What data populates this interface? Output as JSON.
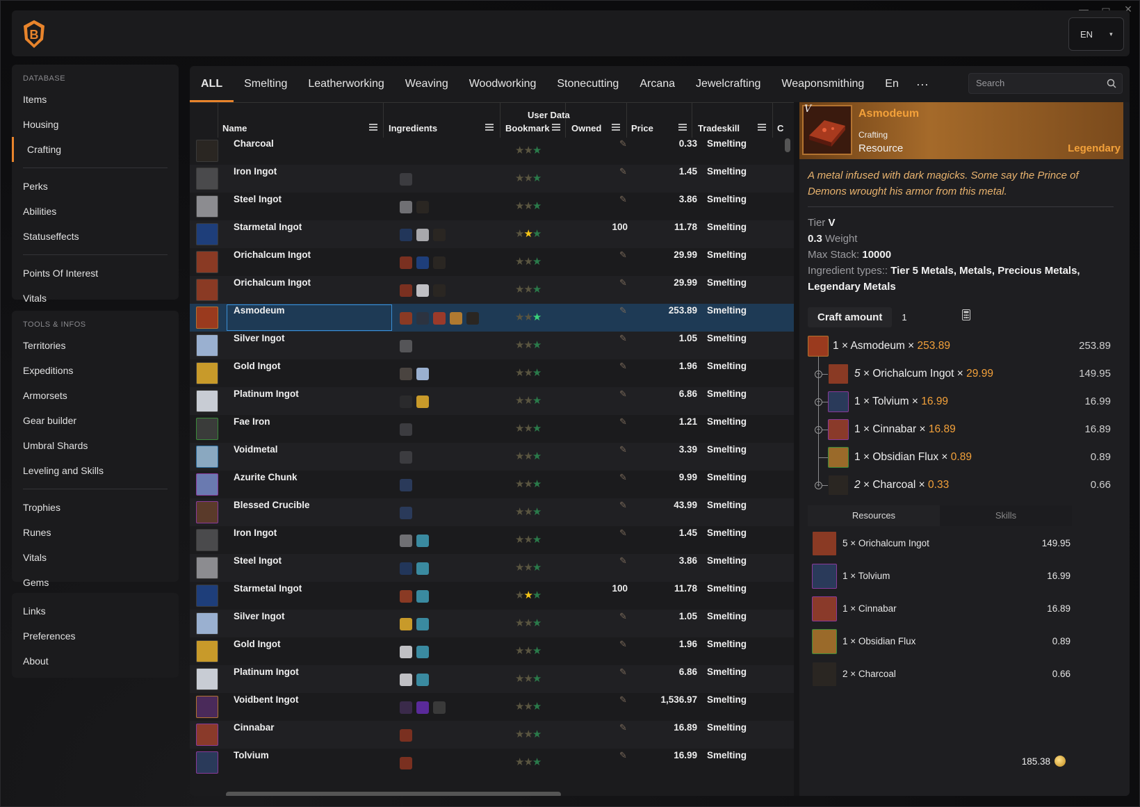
{
  "window": {
    "minimize": "—",
    "maximize": "▭",
    "close": "✕"
  },
  "topbar": {
    "language": "EN",
    "language_caret": "▾"
  },
  "sidebar": {
    "database_heading": "DATABASE",
    "database_items": [
      "Items",
      "Housing",
      "Crafting"
    ],
    "database_items2": [
      "Perks",
      "Abilities",
      "Statuseffects"
    ],
    "database_items3": [
      "Points Of Interest",
      "Vitals"
    ],
    "tools_heading": "TOOLS & INFOS",
    "tools_items": [
      "Territories",
      "Expeditions",
      "Armorsets",
      "Gear builder",
      "Umbral Shards",
      "Leveling and Skills"
    ],
    "tools_items2": [
      "Trophies",
      "Runes",
      "Vitals",
      "Gems"
    ],
    "links_items": [
      "Links",
      "Preferences",
      "About"
    ],
    "active": "Crafting"
  },
  "tabs": [
    "ALL",
    "Smelting",
    "Leatherworking",
    "Weaving",
    "Woodworking",
    "Stonecutting",
    "Arcana",
    "Jewelcrafting",
    "Weaponsmithing",
    "En"
  ],
  "tabs_more": "···",
  "search": {
    "placeholder": "Search"
  },
  "table": {
    "group_header": "User Data",
    "headers": {
      "name": "Name",
      "ingredients": "Ingredients",
      "bookmark": "Bookmark",
      "owned": "Owned",
      "price": "Price",
      "tradeskill": "Tradeskill",
      "extra": "C"
    },
    "rows": [
      {
        "name": "Charcoal",
        "owned": "",
        "price": "0.33",
        "skill": "Smelting",
        "thumb": "#2a2622",
        "frame": "#3a3a3a",
        "ings": [],
        "star": "none"
      },
      {
        "name": "Iron Ingot",
        "owned": "",
        "price": "1.45",
        "skill": "Smelting",
        "thumb": "#4a4a4c",
        "frame": "#3a3a3a",
        "ings": [
          "#3c3c40"
        ],
        "star": "none"
      },
      {
        "name": "Steel Ingot",
        "owned": "",
        "price": "3.86",
        "skill": "Smelting",
        "thumb": "#8c8c90",
        "frame": "#3a3a3a",
        "ings": [
          "#707074",
          "#2a2622"
        ],
        "star": "none"
      },
      {
        "name": "Starmetal Ingot",
        "owned": "100",
        "price": "11.78",
        "skill": "Smelting",
        "thumb": "#1e3e7a",
        "frame": "#3a3a3a",
        "ings": [
          "#22365a",
          "#a8a8ac",
          "#2a2622"
        ],
        "star": "gold"
      },
      {
        "name": "Orichalcum Ingot",
        "owned": "",
        "price": "29.99",
        "skill": "Smelting",
        "thumb": "#8a3a24",
        "frame": "#3a3a3a",
        "ings": [
          "#7a3020",
          "#1e3e7a",
          "#2a2622"
        ],
        "star": "none"
      },
      {
        "name": "Orichalcum Ingot",
        "owned": "",
        "price": "29.99",
        "skill": "Smelting",
        "thumb": "#8a3a24",
        "frame": "#3a3a3a",
        "ings": [
          "#7a3020",
          "#c0c0c4",
          "#2a2622"
        ],
        "star": "none"
      },
      {
        "name": "Asmodeum",
        "owned": "",
        "price": "253.89",
        "skill": "Smelting",
        "thumb": "#9a3a1e",
        "frame": "#b37330",
        "ings": [
          "#8a3a24",
          "#2c3340",
          "#9a3a2a",
          "#b07a30",
          "#2a2622"
        ],
        "star": "green",
        "selected": true
      },
      {
        "name": "Silver Ingot",
        "owned": "",
        "price": "1.05",
        "skill": "Smelting",
        "thumb": "#9ab0d0",
        "frame": "#3a3a3a",
        "ings": [
          "#555558"
        ],
        "star": "none"
      },
      {
        "name": "Gold Ingot",
        "owned": "",
        "price": "1.96",
        "skill": "Smelting",
        "thumb": "#c89a2a",
        "frame": "#3a3a3a",
        "ings": [
          "#4a4440",
          "#9ab0d0"
        ],
        "star": "none"
      },
      {
        "name": "Platinum Ingot",
        "owned": "",
        "price": "6.86",
        "skill": "Smelting",
        "thumb": "#c8ccd4",
        "frame": "#3a3a3a",
        "ings": [
          "#2a2a2c",
          "#c89a2a"
        ],
        "star": "none"
      },
      {
        "name": "Fae Iron",
        "owned": "",
        "price": "1.21",
        "skill": "Smelting",
        "thumb": "#3a3c3a",
        "frame": "#3a8a3a",
        "ings": [
          "#3c3c40"
        ],
        "star": "none"
      },
      {
        "name": "Voidmetal",
        "owned": "",
        "price": "3.39",
        "skill": "Smelting",
        "thumb": "#8aa8c0",
        "frame": "#2a6a9a",
        "ings": [
          "#3c3c40"
        ],
        "star": "none"
      },
      {
        "name": "Azurite Chunk",
        "owned": "",
        "price": "9.99",
        "skill": "Smelting",
        "thumb": "#6a7ab0",
        "frame": "#8a3a9a",
        "ings": [
          "#2a3a5a"
        ],
        "star": "none"
      },
      {
        "name": "Blessed Crucible",
        "owned": "",
        "price": "43.99",
        "skill": "Smelting",
        "thumb": "#5a3a2a",
        "frame": "#8a3a9a",
        "ings": [
          "#2a3a5a"
        ],
        "star": "none"
      },
      {
        "name": "Iron Ingot",
        "owned": "",
        "price": "1.45",
        "skill": "Smelting",
        "thumb": "#4a4a4c",
        "frame": "#3a3a3a",
        "ings": [
          "#707074",
          "#3a8aa0"
        ],
        "star": "none"
      },
      {
        "name": "Steel Ingot",
        "owned": "",
        "price": "3.86",
        "skill": "Smelting",
        "thumb": "#8c8c90",
        "frame": "#3a3a3a",
        "ings": [
          "#22365a",
          "#3a8aa0"
        ],
        "star": "none"
      },
      {
        "name": "Starmetal Ingot",
        "owned": "100",
        "price": "11.78",
        "skill": "Smelting",
        "thumb": "#1e3e7a",
        "frame": "#3a3a3a",
        "ings": [
          "#8a3a24",
          "#3a8aa0"
        ],
        "star": "gold"
      },
      {
        "name": "Silver Ingot",
        "owned": "",
        "price": "1.05",
        "skill": "Smelting",
        "thumb": "#9ab0d0",
        "frame": "#3a3a3a",
        "ings": [
          "#c89a2a",
          "#3a8aa0"
        ],
        "star": "none"
      },
      {
        "name": "Gold Ingot",
        "owned": "",
        "price": "1.96",
        "skill": "Smelting",
        "thumb": "#c89a2a",
        "frame": "#3a3a3a",
        "ings": [
          "#c0c0c4",
          "#3a8aa0"
        ],
        "star": "none"
      },
      {
        "name": "Platinum Ingot",
        "owned": "",
        "price": "6.86",
        "skill": "Smelting",
        "thumb": "#c8ccd4",
        "frame": "#3a3a3a",
        "ings": [
          "#c0c0c4",
          "#3a8aa0"
        ],
        "star": "none"
      },
      {
        "name": "Voidbent Ingot",
        "owned": "",
        "price": "1,536.97",
        "skill": "Smelting",
        "thumb": "#4a2a5a",
        "frame": "#b37330",
        "ings": [
          "#3a2a4a",
          "#5a2a9a",
          "#3a3a3a"
        ],
        "star": "none"
      },
      {
        "name": "Cinnabar",
        "owned": "",
        "price": "16.89",
        "skill": "Smelting",
        "thumb": "#8a3a2a",
        "frame": "#8a3a9a",
        "ings": [
          "#7a3020"
        ],
        "star": "none"
      },
      {
        "name": "Tolvium",
        "owned": "",
        "price": "16.99",
        "skill": "Smelting",
        "thumb": "#2a3a5a",
        "frame": "#8a3a9a",
        "ings": [
          "#7a3020"
        ],
        "star": "none"
      }
    ]
  },
  "detail": {
    "tier_roman": "V",
    "name": "Asmodeum",
    "category": "Crafting",
    "type": "Resource",
    "rarity": "Legendary",
    "description": "A metal infused with dark magicks. Some say the Prince of Demons wrought his armor from this metal.",
    "tier_label": "Tier",
    "tier_value": "V",
    "weight_value": "0.3",
    "weight_label": "Weight",
    "max_stack_label": "Max Stack:",
    "max_stack_value": "10000",
    "ingredient_types_label": "Ingredient types::",
    "ingredient_types_value": "Tier 5 Metals, Metals, Precious Metals, Legendary Metals",
    "craft_amount_label": "Craft amount",
    "craft_amount_value": "1",
    "tree": [
      {
        "qty": "1",
        "name": "Asmodeum",
        "price": "253.89",
        "total": "253.89",
        "color": "#9a3a1e",
        "frame": "#b37330"
      },
      {
        "qty": "5",
        "name": "Orichalcum Ingot",
        "price": "29.99",
        "total": "149.95",
        "color": "#8a3a24",
        "frame": "#1e1e21"
      },
      {
        "qty": "1",
        "name": "Tolvium",
        "price": "16.99",
        "total": "16.99",
        "color": "#2a3a5a",
        "frame": "#8a3a9a"
      },
      {
        "qty": "1",
        "name": "Cinnabar",
        "price": "16.89",
        "total": "16.89",
        "color": "#8a3a2a",
        "frame": "#8a3a9a"
      },
      {
        "qty": "1",
        "name": "Obsidian Flux",
        "price": "0.89",
        "total": "0.89",
        "color": "#9a6a2a",
        "frame": "#3a8a3a"
      },
      {
        "qty": "2",
        "name": "Charcoal",
        "price": "0.33",
        "total": "0.66",
        "color": "#2a2622",
        "frame": "#1e1e21"
      }
    ],
    "times": "×",
    "resource_tabs": [
      "Resources",
      "Skills"
    ],
    "resources": [
      {
        "label": "5 × Orichalcum Ingot",
        "value": "149.95",
        "color": "#8a3a24",
        "frame": "#1e1e21"
      },
      {
        "label": "1 × Tolvium",
        "value": "16.99",
        "color": "#2a3a5a",
        "frame": "#8a3a9a"
      },
      {
        "label": "1 × Cinnabar",
        "value": "16.89",
        "color": "#8a3a2a",
        "frame": "#8a3a9a"
      },
      {
        "label": "1 × Obsidian Flux",
        "value": "0.89",
        "color": "#9a6a2a",
        "frame": "#3a8a3a"
      },
      {
        "label": "2 × Charcoal",
        "value": "0.66",
        "color": "#2a2622",
        "frame": "#1e1e21"
      }
    ],
    "total": "185.38"
  }
}
